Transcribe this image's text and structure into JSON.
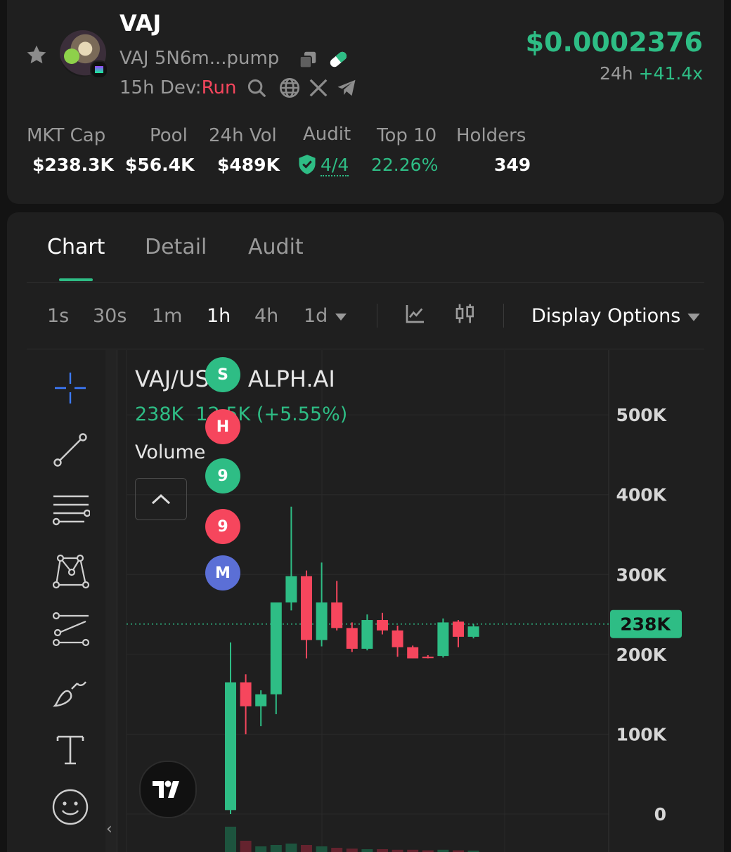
{
  "token": {
    "ticker": "VAJ",
    "name_short": "VAJ",
    "address": "5N6m...pump",
    "age": "15h",
    "dev_label": "Dev:",
    "dev_status": "Run",
    "price": "$0.0002376",
    "change_period": "24h",
    "change_value": "+41.4x"
  },
  "stats": [
    {
      "label": "MKT Cap",
      "value": "$238.3K"
    },
    {
      "label": "Pool",
      "value": "$56.4K"
    },
    {
      "label": "24h Vol",
      "value": "$489K"
    },
    {
      "label": "Audit",
      "value": "4/4"
    },
    {
      "label": "Top 10",
      "value": "22.26%"
    },
    {
      "label": "Holders",
      "value": "349"
    }
  ],
  "tabs": [
    "Chart",
    "Detail",
    "Audit"
  ],
  "active_tab": "Chart",
  "timeframes": [
    "1s",
    "30s",
    "1m",
    "1h",
    "4h",
    "1d"
  ],
  "active_timeframe": "1h",
  "display_options": "Display Options",
  "chart_legend": {
    "symbol": "VAJ/USD · ALPH.AI",
    "last": "238K",
    "change": "12.5K (+5.55%)",
    "volume_label": "Volume"
  },
  "markers": [
    {
      "label": "S",
      "color": "#2ebd85"
    },
    {
      "label": "H",
      "color": "#f6465d"
    },
    {
      "label": "9",
      "color": "#2ebd85"
    },
    {
      "label": "9",
      "color": "#f6465d"
    },
    {
      "label": "M",
      "color": "#5b6fd6"
    }
  ],
  "colors": {
    "up": "#2ebd85",
    "down": "#f6465d",
    "accent": "#2ebd85",
    "marker_m": "#5b6fd6"
  },
  "chart_data": {
    "type": "candlestick",
    "y_ticks": [
      "500K",
      "400K",
      "300K",
      "200K",
      "100K",
      "0"
    ],
    "ylim": [
      0,
      560000
    ],
    "current_price_label": "238K",
    "current_price": 238000,
    "candles": [
      {
        "o": 5000,
        "h": 215000,
        "l": 0,
        "c": 165000,
        "v": 0.9
      },
      {
        "o": 165000,
        "h": 175000,
        "l": 100000,
        "c": 135000,
        "v": 0.4
      },
      {
        "o": 135000,
        "h": 155000,
        "l": 110000,
        "c": 150000,
        "v": 0.2
      },
      {
        "o": 150000,
        "h": 250000,
        "l": 125000,
        "c": 265000,
        "v": 0.25
      },
      {
        "o": 265000,
        "h": 385000,
        "l": 255000,
        "c": 298000,
        "v": 0.3
      },
      {
        "o": 298000,
        "h": 305000,
        "l": 195000,
        "c": 218000,
        "v": 0.25
      },
      {
        "o": 218000,
        "h": 315000,
        "l": 210000,
        "c": 265000,
        "v": 0.2
      },
      {
        "o": 265000,
        "h": 292000,
        "l": 230000,
        "c": 233000,
        "v": 0.15
      },
      {
        "o": 233000,
        "h": 240000,
        "l": 203000,
        "c": 207000,
        "v": 0.12
      },
      {
        "o": 207000,
        "h": 250000,
        "l": 205000,
        "c": 243000,
        "v": 0.1
      },
      {
        "o": 243000,
        "h": 252000,
        "l": 225000,
        "c": 230000,
        "v": 0.1
      },
      {
        "o": 230000,
        "h": 236000,
        "l": 197000,
        "c": 209000,
        "v": 0.08
      },
      {
        "o": 209000,
        "h": 211000,
        "l": 195000,
        "c": 195000,
        "v": 0.08
      },
      {
        "o": 197000,
        "h": 199000,
        "l": 195000,
        "c": 196000,
        "v": 0.06
      },
      {
        "o": 198000,
        "h": 245000,
        "l": 196000,
        "c": 240000,
        "v": 0.08
      },
      {
        "o": 241000,
        "h": 243000,
        "l": 209000,
        "c": 222000,
        "v": 0.06
      },
      {
        "o": 222000,
        "h": 238000,
        "l": 220000,
        "c": 235000,
        "v": 0.05
      }
    ]
  }
}
